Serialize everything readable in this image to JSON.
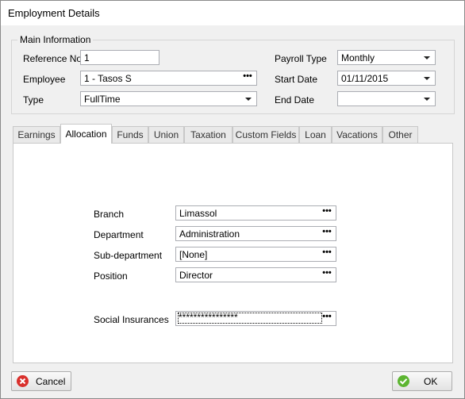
{
  "window": {
    "title": "Employment Details"
  },
  "main_info": {
    "legend": "Main Information",
    "reference_no": {
      "label": "Reference No",
      "value": "1"
    },
    "employee": {
      "label": "Employee",
      "value": "1 - Tasos S"
    },
    "type": {
      "label": "Type",
      "value": "FullTime"
    },
    "payroll_type": {
      "label": "Payroll Type",
      "value": "Monthly"
    },
    "start_date": {
      "label": "Start Date",
      "value": "01/11/2015"
    },
    "end_date": {
      "label": "End Date",
      "value": ""
    }
  },
  "tabs": [
    {
      "label": "Earnings",
      "active": false
    },
    {
      "label": "Allocation",
      "active": true
    },
    {
      "label": "Funds",
      "active": false
    },
    {
      "label": "Union",
      "active": false
    },
    {
      "label": "Taxation",
      "active": false
    },
    {
      "label": "Custom Fields",
      "active": false
    },
    {
      "label": "Loan",
      "active": false
    },
    {
      "label": "Vacations",
      "active": false
    },
    {
      "label": "Other",
      "active": false
    }
  ],
  "allocation": {
    "branch": {
      "label": "Branch",
      "value": "Limassol"
    },
    "department": {
      "label": "Department",
      "value": "Administration"
    },
    "sub_department": {
      "label": "Sub-department",
      "value": "[None]"
    },
    "position": {
      "label": "Position",
      "value": "Director"
    },
    "social_insurances": {
      "label": "Social Insurances",
      "value": "****************"
    }
  },
  "ellipsis": "•••",
  "buttons": {
    "cancel": "Cancel",
    "ok": "OK"
  },
  "colors": {
    "cancel_icon": "#d9302c",
    "ok_icon": "#5cb531"
  }
}
